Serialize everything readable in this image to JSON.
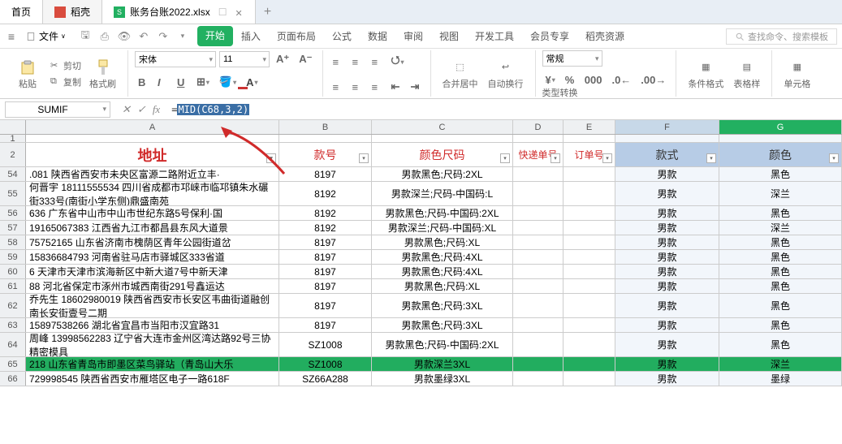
{
  "tabs": {
    "home": "首页",
    "daoke": "稻壳",
    "file": "账务台账2022.xlsx",
    "add": "+"
  },
  "menu": {
    "file": "文件",
    "ribbon": [
      "开始",
      "插入",
      "页面布局",
      "公式",
      "数据",
      "审阅",
      "视图",
      "开发工具",
      "会员专享",
      "稻壳资源"
    ],
    "search_ph": "查找命令、搜索模板"
  },
  "ribbon": {
    "paste": "粘贴",
    "cut": "剪切",
    "copy": "复制",
    "format_painter": "格式刷",
    "font": "宋体",
    "size": "11",
    "bold": "B",
    "italic": "I",
    "underline": "U",
    "Aplus": "A⁺",
    "Aminus": "A⁻",
    "merge": "合并居中",
    "wrap": "自动换行",
    "num_fmt": "常规",
    "type_conv": "类型转换",
    "cond_fmt": "条件格式",
    "tbl_style": "表格样",
    "cell_fmt": "单元格"
  },
  "formula_bar": {
    "name": "SUMIF",
    "equals": "=",
    "formula": "MID(C68,3,2)"
  },
  "columns": [
    "A",
    "B",
    "C",
    "D",
    "E",
    "F",
    "G"
  ],
  "header_row_num": "2",
  "header": {
    "A": "地址",
    "B": "款号",
    "C": "颜色尺码",
    "D": "快递单号",
    "E": "订单号",
    "F": "款式",
    "G": "颜色"
  },
  "chart_data": {
    "type": "table",
    "filter_row": "1",
    "rows": [
      {
        "n": "54",
        "h": 1,
        "A": ".081  陕西省西安市未央区富源二路附近立丰·",
        "B": "8197",
        "C": "男款黑色;尺码:2XL",
        "F": "男款",
        "G": "黑色"
      },
      {
        "n": "55",
        "h": 2,
        "A": "何晋宇 18111555534  四川省成都市邛崃市临邛镇朱水碾街333号(南街小学东侧)鼎盛南苑",
        "B": "8192",
        "C": "男款深兰;尺码-中国码:L",
        "F": "男款",
        "G": "深兰"
      },
      {
        "n": "56",
        "h": 1,
        "A": "636  广东省中山市中山市世纪东路5号保利·国",
        "B": "8192",
        "C": "男款黑色;尺码-中国码:2XL",
        "F": "男款",
        "G": "黑色"
      },
      {
        "n": "57",
        "h": 1,
        "A": "19165067383  江西省九江市都昌县东风大道景",
        "B": "8192",
        "C": "男款深兰;尺码-中国码:XL",
        "F": "男款",
        "G": "深兰"
      },
      {
        "n": "58",
        "h": 1,
        "A": "75752165  山东省济南市槐荫区青年公园街道岔",
        "B": "8197",
        "C": "男款黑色;尺码:XL",
        "F": "男款",
        "G": "黑色"
      },
      {
        "n": "59",
        "h": 1,
        "A": "15836684793  河南省驻马店市驿城区333省道",
        "B": "8197",
        "C": "男款黑色;尺码:4XL",
        "F": "男款",
        "G": "黑色"
      },
      {
        "n": "60",
        "h": 1,
        "A": "6 天津市天津市滨海新区中新大道7号中新天津",
        "B": "8197",
        "C": "男款黑色;尺码:4XL",
        "F": "男款",
        "G": "黑色"
      },
      {
        "n": "61",
        "h": 1,
        "A": "88  河北省保定市涿州市城西南街291号鑫运达",
        "B": "8197",
        "C": "男款黑色;尺码:XL",
        "F": "男款",
        "G": "黑色"
      },
      {
        "n": "62",
        "h": 2,
        "A": "乔先生 18602980019  陕西省西安市长安区韦曲街道融创南长安街壹号二期",
        "B": "8197",
        "C": "男款黑色;尺码:3XL",
        "F": "男款",
        "G": "黑色"
      },
      {
        "n": "63",
        "h": 1,
        "A": "15897538266  湖北省宜昌市当阳市汉宜路31",
        "B": "8197",
        "C": "男款黑色;尺码:3XL",
        "F": "男款",
        "G": "黑色"
      },
      {
        "n": "64",
        "h": 2,
        "A": "周峰 13998562283  辽宁省大连市金州区湾达路92号三协精密模具",
        "B": "SZ1008",
        "C": "男款黑色;尺码-中国码:2XL",
        "F": "男款",
        "G": "黑色"
      },
      {
        "n": "65",
        "h": 1,
        "green": true,
        "A": "218 山东省青岛市即墨区菜鸟驿站（青岛山大乐",
        "B": "SZ1008",
        "C": "男款深兰3XL",
        "F": "男款",
        "G": "深兰"
      },
      {
        "n": "66",
        "h": 1,
        "A": "729998545  陕西省西安市雁塔区电子一路618F",
        "B": "SZ66A288",
        "C": "男款墨绿3XL",
        "F": "男款",
        "G": "墨绿"
      }
    ]
  }
}
